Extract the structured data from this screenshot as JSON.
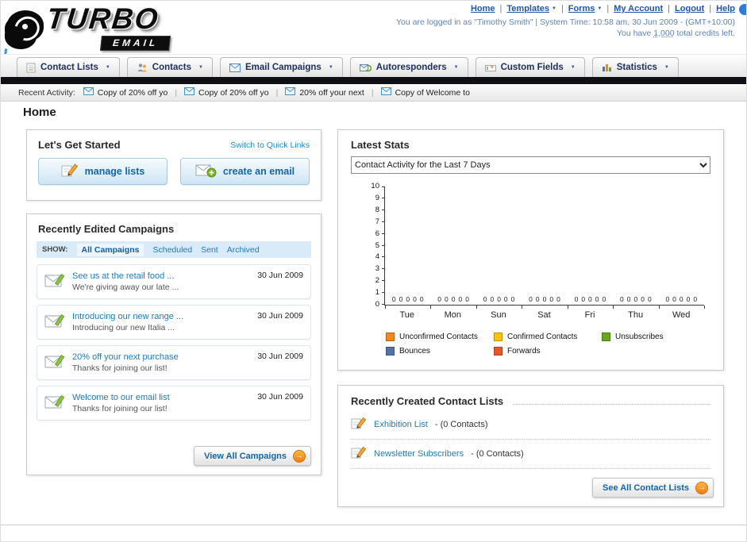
{
  "page": {
    "title_heading": "Home"
  },
  "header": {
    "logo_primary": "TURBO",
    "logo_secondary": "EMAIL",
    "links": [
      "Home",
      "Templates",
      "Forms",
      "My Account",
      "Logout",
      "Help"
    ],
    "login_info": "You are logged in as \"Timothy Smith\" | System Time: 10:58 am, 30 Jun 2009 - (GMT+10:00)",
    "credits_prefix": "You have",
    "credits_value": "1,000",
    "credits_suffix": "total credits left."
  },
  "nav": {
    "items": [
      {
        "label": "Contact Lists",
        "icon": "contact-lists-icon"
      },
      {
        "label": "Contacts",
        "icon": "contacts-icon"
      },
      {
        "label": "Email Campaigns",
        "icon": "email-campaigns-icon"
      },
      {
        "label": "Autoresponders",
        "icon": "autoresponders-icon"
      },
      {
        "label": "Custom Fields",
        "icon": "custom-fields-icon"
      },
      {
        "label": "Statistics",
        "icon": "statistics-icon"
      }
    ]
  },
  "recent_activity": {
    "label": "Recent Activity:",
    "items": [
      "Copy of 20% off yo",
      "Copy of 20% off yo",
      "20% off your next",
      "Copy of Welcome to"
    ]
  },
  "get_started": {
    "title": "Let's Get Started",
    "switch_link": "Switch to Quick Links",
    "manage_lists_button": "manage lists",
    "create_email_button": "create an email"
  },
  "campaigns": {
    "title": "Recently Edited Campaigns",
    "show_label": "SHOW:",
    "filters": [
      "All Campaigns",
      "Scheduled",
      "Sent",
      "Archived"
    ],
    "items": [
      {
        "title": "See us at the retail food ...",
        "subtitle": "We're giving away our late ...",
        "date": "30 Jun 2009"
      },
      {
        "title": "Introducing our new range ...",
        "subtitle": "Introducing our new Italia ...",
        "date": "30 Jun 2009"
      },
      {
        "title": "20% off your next purchase",
        "subtitle": "Thanks for joining our list!",
        "date": "30 Jun 2009"
      },
      {
        "title": "Welcome to our email list",
        "subtitle": "Thanks for joining our list!",
        "date": "30 Jun 2009"
      }
    ],
    "view_all_button": "View All Campaigns"
  },
  "latest_stats": {
    "title": "Latest Stats",
    "selected_option": "Contact Activity for the Last 7 Days"
  },
  "chart_data": {
    "type": "bar",
    "title": "Contact Activity for the Last 7 Days",
    "categories": [
      "Tue",
      "Mon",
      "Sun",
      "Sat",
      "Fri",
      "Thu",
      "Wed"
    ],
    "series": [
      {
        "name": "Unconfirmed Contacts",
        "color": "#f6861f",
        "values": [
          0,
          0,
          0,
          0,
          0,
          0,
          0
        ]
      },
      {
        "name": "Confirmed Contacts",
        "color": "#fdc113",
        "values": [
          0,
          0,
          0,
          0,
          0,
          0,
          0
        ]
      },
      {
        "name": "Unsubscribes",
        "color": "#64a81c",
        "values": [
          0,
          0,
          0,
          0,
          0,
          0,
          0
        ]
      },
      {
        "name": "Bounces",
        "color": "#5471a9",
        "values": [
          0,
          0,
          0,
          0,
          0,
          0,
          0
        ]
      },
      {
        "name": "Forwards",
        "color": "#e8552d",
        "values": [
          0,
          0,
          0,
          0,
          0,
          0,
          0
        ]
      }
    ],
    "ylim": [
      0,
      10
    ],
    "yticks": [
      10,
      9,
      8,
      7,
      6,
      5,
      4,
      3,
      2,
      1,
      0
    ],
    "grid": false,
    "legend_position": "bottom"
  },
  "contact_lists": {
    "title": "Recently Created Contact Lists",
    "items": [
      {
        "name": "Exhibition List",
        "count": "- (0 Contacts)"
      },
      {
        "name": "Newsletter Subscribers",
        "count": "- (0 Contacts)"
      }
    ],
    "see_all_button": "See All Contact Lists"
  }
}
